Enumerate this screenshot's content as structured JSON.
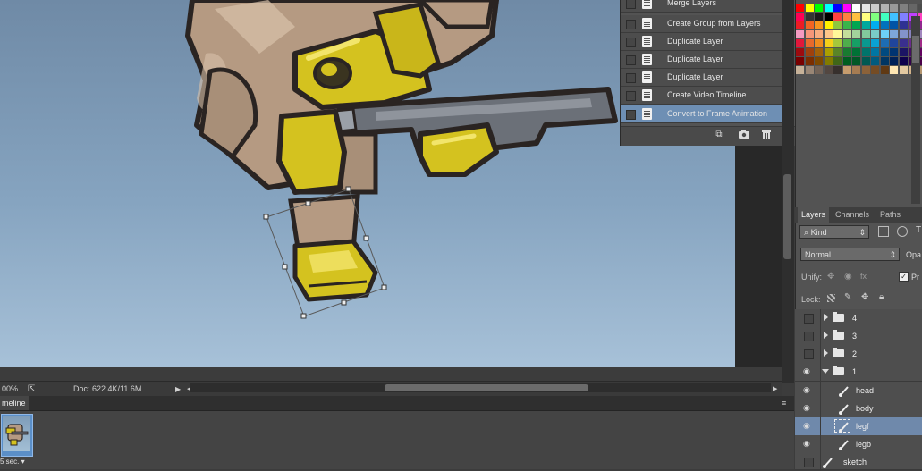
{
  "history": {
    "items": [
      {
        "label": "Merge Layers",
        "selected": false
      },
      {
        "label": "Create Group from Layers",
        "selected": false
      },
      {
        "label": "Duplicate Layer",
        "selected": false
      },
      {
        "label": "Duplicate Layer",
        "selected": false
      },
      {
        "label": "Duplicate Layer",
        "selected": false
      },
      {
        "label": "Create Video Timeline",
        "selected": false
      },
      {
        "label": "Convert to Frame Animation",
        "selected": true
      }
    ],
    "footer_icons": [
      "new-document-from-state-icon",
      "camera-icon",
      "trash-icon"
    ]
  },
  "status_bar": {
    "zoom": "00%",
    "doc_info": "Doc: 622.4K/11.6M"
  },
  "timeline": {
    "tab_label": "meline",
    "frame_delay": "5 sec."
  },
  "layers_panel": {
    "tabs": [
      "Layers",
      "Channels",
      "Paths"
    ],
    "filter_placeholder": "Kind",
    "blend_mode": "Normal",
    "opacity_label": "Opa",
    "unify_label": "Unify:",
    "propagate_label": "Pr",
    "lock_label": "Lock:",
    "layers": [
      {
        "name": "4",
        "type": "group",
        "visible": false,
        "expanded": false,
        "selected": false
      },
      {
        "name": "3",
        "type": "group",
        "visible": false,
        "expanded": false,
        "selected": false
      },
      {
        "name": "2",
        "type": "group",
        "visible": false,
        "expanded": false,
        "selected": false
      },
      {
        "name": "1",
        "type": "group",
        "visible": true,
        "expanded": true,
        "selected": false
      },
      {
        "name": "head",
        "type": "layer",
        "visible": true,
        "selected": false
      },
      {
        "name": "body",
        "type": "layer",
        "visible": true,
        "selected": false
      },
      {
        "name": "legf",
        "type": "layer",
        "visible": true,
        "selected": true
      },
      {
        "name": "legb",
        "type": "layer",
        "visible": true,
        "selected": false
      },
      {
        "name": "sketch",
        "type": "layer",
        "visible": false,
        "selected": false
      }
    ]
  },
  "colors": {
    "canvas_top": "#6f8aa6",
    "canvas_bottom": "#a7c1d8",
    "panel_bg": "#535353",
    "selection": "#6f89ab",
    "character_yellow": "#d4c21f",
    "character_tan": "#b9a08a",
    "gun_gray": "#6b7078"
  }
}
